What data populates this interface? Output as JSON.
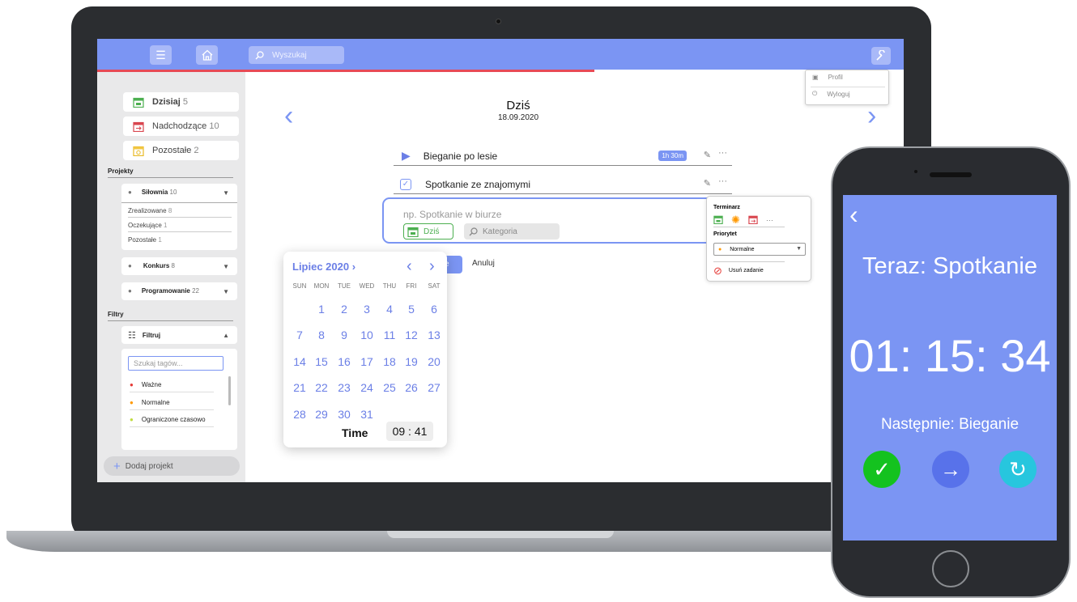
{
  "topbar": {
    "search_placeholder": "Wyszukaj"
  },
  "user_menu": {
    "profile": "Profil",
    "logout": "Wyloguj"
  },
  "sidebar": {
    "nav": [
      {
        "label": "Dzisiaj",
        "count": "5",
        "icon": "calendar-today-icon",
        "color": "#4caf50"
      },
      {
        "label": "Nadchodzące",
        "count": "10",
        "icon": "calendar-upcoming-icon",
        "color": "#d9464f"
      },
      {
        "label": "Pozostałe",
        "count": "2",
        "icon": "calendar-other-icon",
        "color": "#f2c744"
      }
    ],
    "projects_header": "Projekty",
    "projects": [
      {
        "name": "Siłownia",
        "count": "10",
        "subs": [
          {
            "label": "Zrealizowane",
            "count": "8"
          },
          {
            "label": "Oczekujące",
            "count": "1"
          },
          {
            "label": "Pozostałe",
            "count": "1"
          }
        ]
      },
      {
        "name": "Konkurs",
        "count": "8"
      },
      {
        "name": "Programowanie",
        "count": "22"
      }
    ],
    "filters_header": "Filtry",
    "filter_label": "Filtruj",
    "tag_search_placeholder": "Szukaj tagów...",
    "tags": [
      {
        "label": "Ważne",
        "color": "#e53935"
      },
      {
        "label": "Normalne",
        "color": "#ff9800"
      },
      {
        "label": "Ograniczone czasowo",
        "color": "#c0dc3e"
      }
    ],
    "add_project": "Dodaj projekt"
  },
  "main": {
    "title": "Dziś",
    "date": "18.09.2020",
    "tasks": [
      {
        "title": "Bieganie po lesie",
        "duration": "1h 30m"
      },
      {
        "title": "Spotkanie ze znajomymi"
      }
    ],
    "new_task": {
      "placeholder": "np. Spotkanie w biurze",
      "date_chip": "Dziś",
      "category_placeholder": "Kategoria",
      "save_label": "e",
      "cancel_label": "Anuluj"
    }
  },
  "task_menu": {
    "schedule_label": "Terminarz",
    "priority_label": "Priorytet",
    "priority_value": "Normalne",
    "priority_color": "#ff9800",
    "delete_label": "Usuń zadanie"
  },
  "calendar": {
    "month": "Lipiec 2020 ›",
    "weekdays": [
      "SUN",
      "MON",
      "TUE",
      "WED",
      "THU",
      "FRI",
      "SAT"
    ],
    "weeks": [
      [
        "",
        "1",
        "2",
        "3",
        "4",
        "5",
        "6"
      ],
      [
        "7",
        "8",
        "9",
        "10",
        "11",
        "12",
        "13"
      ],
      [
        "14",
        "15",
        "16",
        "17",
        "18",
        "19",
        "20"
      ],
      [
        "21",
        "22",
        "23",
        "24",
        "25",
        "26",
        "27"
      ],
      [
        "28",
        "29",
        "30",
        "31",
        "",
        "",
        ""
      ]
    ],
    "time_label": "Time",
    "time_value": "09 : 41"
  },
  "phone": {
    "now": "Teraz: Spotkanie",
    "timer": "01: 15: 34",
    "next": "Następnie: Bieganie"
  },
  "colors": {
    "accent": "#7b95f3",
    "progress": "#e74a56"
  }
}
